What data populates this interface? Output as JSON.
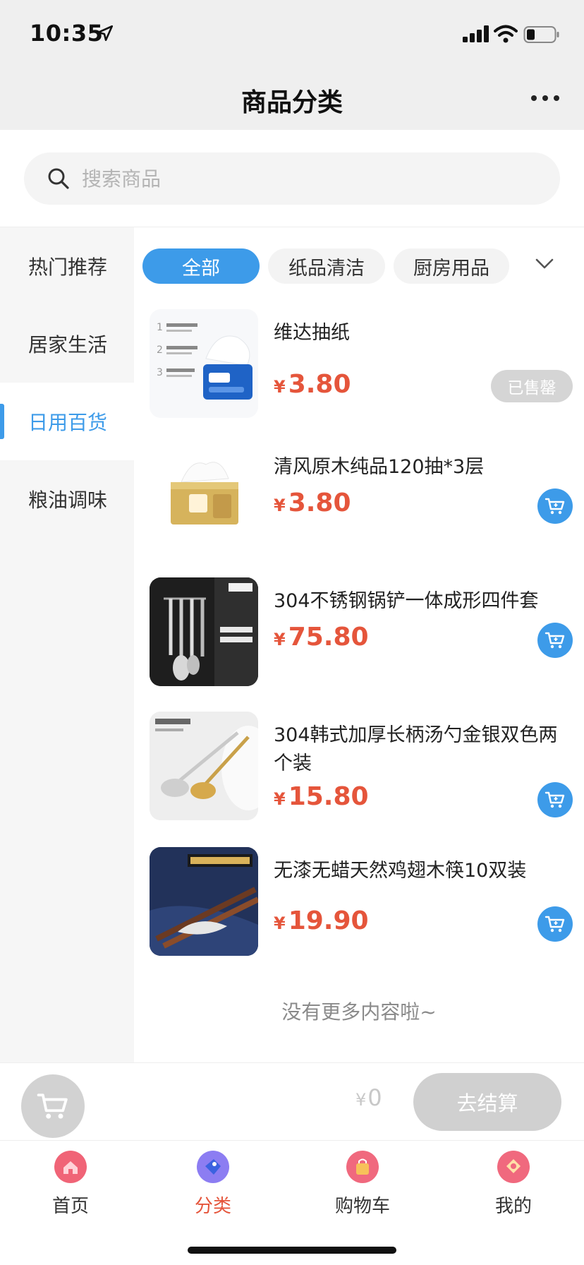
{
  "status_bar": {
    "time": "10:35"
  },
  "nav": {
    "title": "商品分类"
  },
  "search": {
    "placeholder": "搜索商品"
  },
  "sidebar": {
    "items": [
      {
        "label": "热门推荐",
        "active": false
      },
      {
        "label": "居家生活",
        "active": false
      },
      {
        "label": "日用百货",
        "active": true
      },
      {
        "label": "粮油调味",
        "active": false
      }
    ]
  },
  "filters": {
    "chips": [
      {
        "label": "全部",
        "active": true
      },
      {
        "label": "纸品清洁",
        "active": false
      },
      {
        "label": "厨房用品",
        "active": false
      }
    ]
  },
  "products": [
    {
      "name": "维达抽纸",
      "currency": "¥",
      "price": "3.80",
      "status": "已售罄"
    },
    {
      "name": "清风原木纯品120抽*3层",
      "currency": "¥",
      "price": "3.80",
      "status": ""
    },
    {
      "name": "304不锈钢锅铲一体成形四件套",
      "currency": "¥",
      "price": "75.80",
      "status": ""
    },
    {
      "name": "304韩式加厚长柄汤勺金银双色两个装",
      "currency": "¥",
      "price": "15.80",
      "status": ""
    },
    {
      "name": "无漆无蜡天然鸡翅木筷10双装",
      "currency": "¥",
      "price": "19.90",
      "status": ""
    }
  ],
  "list_footer": "没有更多内容啦~",
  "checkout": {
    "currency": "¥",
    "total": "0",
    "button_label": "去结算"
  },
  "tabbar": {
    "items": [
      {
        "label": "首页",
        "icon": "home-icon",
        "active": false
      },
      {
        "label": "分类",
        "icon": "category-icon",
        "active": true
      },
      {
        "label": "购物车",
        "icon": "shopping-bag-icon",
        "active": false
      },
      {
        "label": "我的",
        "icon": "profile-icon",
        "active": false
      }
    ]
  },
  "colors": {
    "accent": "#3d9be9",
    "price": "#e5553b",
    "disabled": "#d0d0d0"
  }
}
